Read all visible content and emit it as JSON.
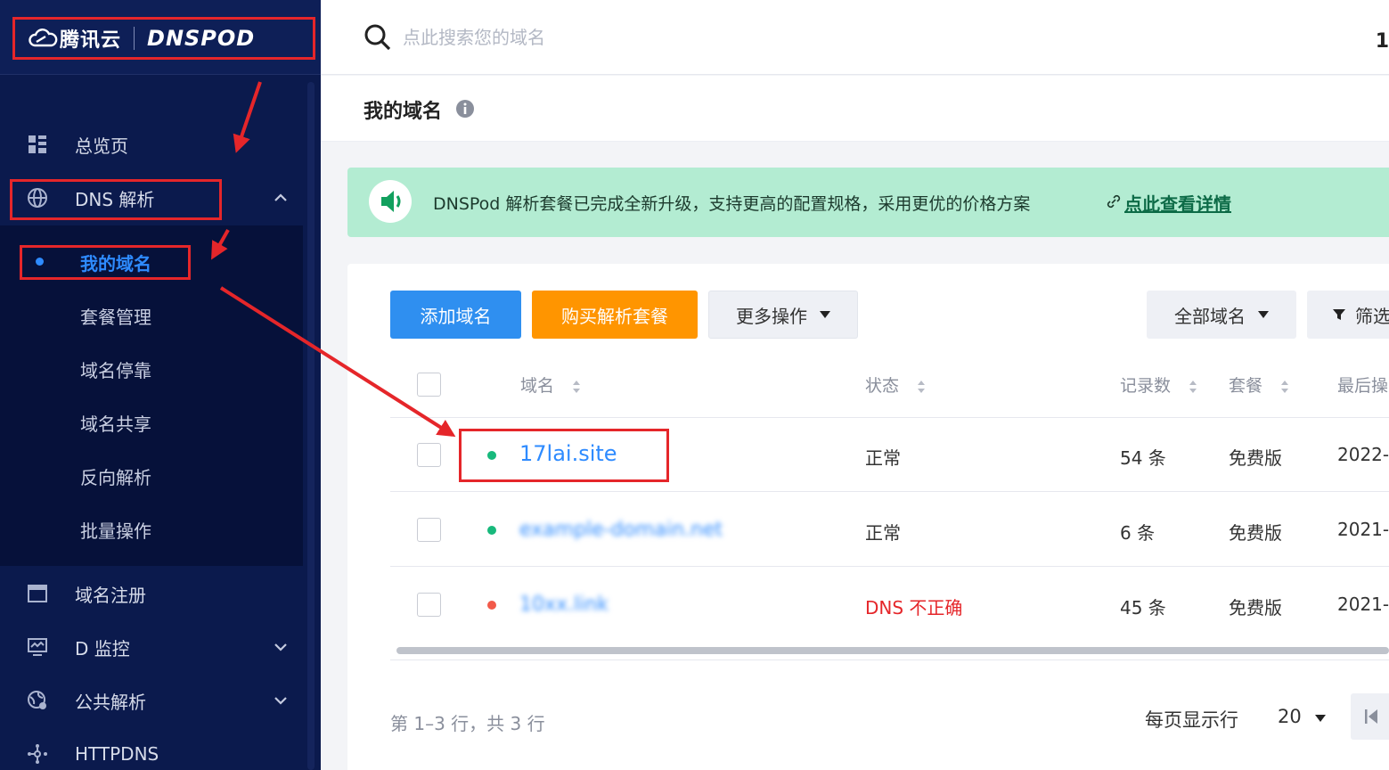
{
  "brand": {
    "name_cn": "腾讯云",
    "name_en": "DNSPOD"
  },
  "sidebar": {
    "items": [
      {
        "label": "总览页",
        "icon": "dashboard-icon"
      },
      {
        "label": "DNS 解析",
        "icon": "globe-icon",
        "expanded": true
      },
      {
        "label": "域名注册",
        "icon": "browser-window-icon"
      },
      {
        "label": "D 监控",
        "icon": "monitor-icon"
      },
      {
        "label": "公共解析",
        "icon": "public-dns-icon"
      },
      {
        "label": "HTTPDNS",
        "icon": "network-nodes-icon"
      }
    ],
    "dns_submenu": [
      {
        "label": "我的域名",
        "active": true
      },
      {
        "label": "套餐管理"
      },
      {
        "label": "域名停靠"
      },
      {
        "label": "域名共享"
      },
      {
        "label": "反向解析"
      },
      {
        "label": "批量操作"
      }
    ]
  },
  "search": {
    "placeholder": "点此搜索您的域名"
  },
  "topbar": {
    "edge_text": "1"
  },
  "page": {
    "title": "我的域名"
  },
  "notice": {
    "text": "DNSPod 解析套餐已完成全新升级，支持更高的配置规格，采用更优的价格方案",
    "link": "点此查看详情"
  },
  "toolbar": {
    "add": "添加域名",
    "buy": "购买解析套餐",
    "more": "更多操作",
    "all_domains": "全部域名",
    "filter": "筛选"
  },
  "table": {
    "headers": {
      "domain": "域名",
      "status": "状态",
      "records": "记录数",
      "plan": "套餐",
      "last": "最后操"
    },
    "rows": [
      {
        "domain": "17lai.site",
        "status": "正常",
        "status_ok": true,
        "records": "54 条",
        "plan": "免费版",
        "last": "2022-"
      },
      {
        "domain": "example-domain.net",
        "status": "正常",
        "status_ok": true,
        "records": "6 条",
        "plan": "免费版",
        "last": "2021-"
      },
      {
        "domain": "10xx.link",
        "status": "DNS 不正确",
        "status_ok": false,
        "records": "45 条",
        "plan": "免费版",
        "last": "2021-"
      }
    ]
  },
  "pagination": {
    "summary": "第 1–3 行，共 3 行",
    "per_page_label": "每页显示行",
    "per_page": "20"
  },
  "colors": {
    "sidebar_bg": "#0b1a4d",
    "accent": "#2e8bff",
    "buy": "#ff9500",
    "notice_bg": "#b3ecd2",
    "ok": "#18b97c",
    "error": "#e5262a",
    "annotation": "#e5262a"
  }
}
